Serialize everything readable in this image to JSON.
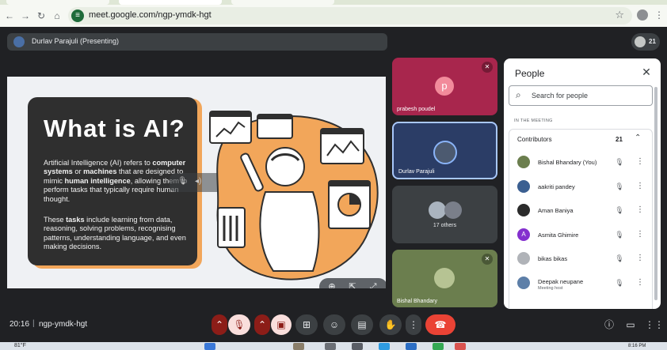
{
  "browser": {
    "url": "meet.google.com/ngp-ymdk-hgt"
  },
  "header": {
    "presenter_label": "Durlav Parajuli (Presenting)",
    "participant_count": "21"
  },
  "slide": {
    "title": "What is AI?",
    "para1_parts": [
      "Artificial Intelligence (AI) refers to ",
      "computer systems",
      " or ",
      "machines",
      " that are designed to mimic ",
      "human intelligence",
      ", allowing them to perform tasks that typically require human thought."
    ],
    "para2_parts": [
      "These ",
      "tasks",
      " include learning from data, reasoning, solving problems, recognising patterns, understanding language, and even making decisions."
    ]
  },
  "tiles": [
    {
      "name": "prabesh poudel",
      "initial": "p"
    },
    {
      "name": "Durlav Parajuli"
    },
    {
      "name": "17 others"
    },
    {
      "name": "Bishal Bhandary"
    }
  ],
  "people_panel": {
    "title": "People",
    "search_placeholder": "Search for people",
    "section_label": "IN THE MEETING",
    "group_label": "Contributors",
    "group_count": "21",
    "people": [
      {
        "name": "Bishal Bhandary (You)",
        "role": "",
        "initial": "",
        "color": "#6b7e4e"
      },
      {
        "name": "aakriti pandey",
        "role": "",
        "initial": "",
        "color": "#3b5f91"
      },
      {
        "name": "Aman Baniya",
        "role": "",
        "initial": "",
        "color": "#2b2b2b"
      },
      {
        "name": "Asmita Ghimire",
        "role": "",
        "initial": "A",
        "color": "#8430ce"
      },
      {
        "name": "bikas bikas",
        "role": "",
        "initial": "",
        "color": "#b0b3b8"
      },
      {
        "name": "Deepak neupane",
        "role": "Meeting host",
        "initial": "",
        "color": "#5d7fa8"
      }
    ]
  },
  "bottom_bar": {
    "time": "20:16",
    "separator": "|",
    "meeting_code": "ngp-ymdk-hgt"
  },
  "taskbar": {
    "weather": "81°F",
    "time": "8:16 PM"
  },
  "icons": {
    "mic_off": "mic-off-icon",
    "cam_off": "camera-off-icon",
    "present": "present-icon",
    "emoji": "emoji-icon",
    "captions": "captions-icon",
    "hand": "raise-hand-icon",
    "more": "more-icon",
    "hangup": "hangup-icon",
    "info": "info-icon",
    "chat": "chat-icon",
    "activities": "grid-icon"
  }
}
